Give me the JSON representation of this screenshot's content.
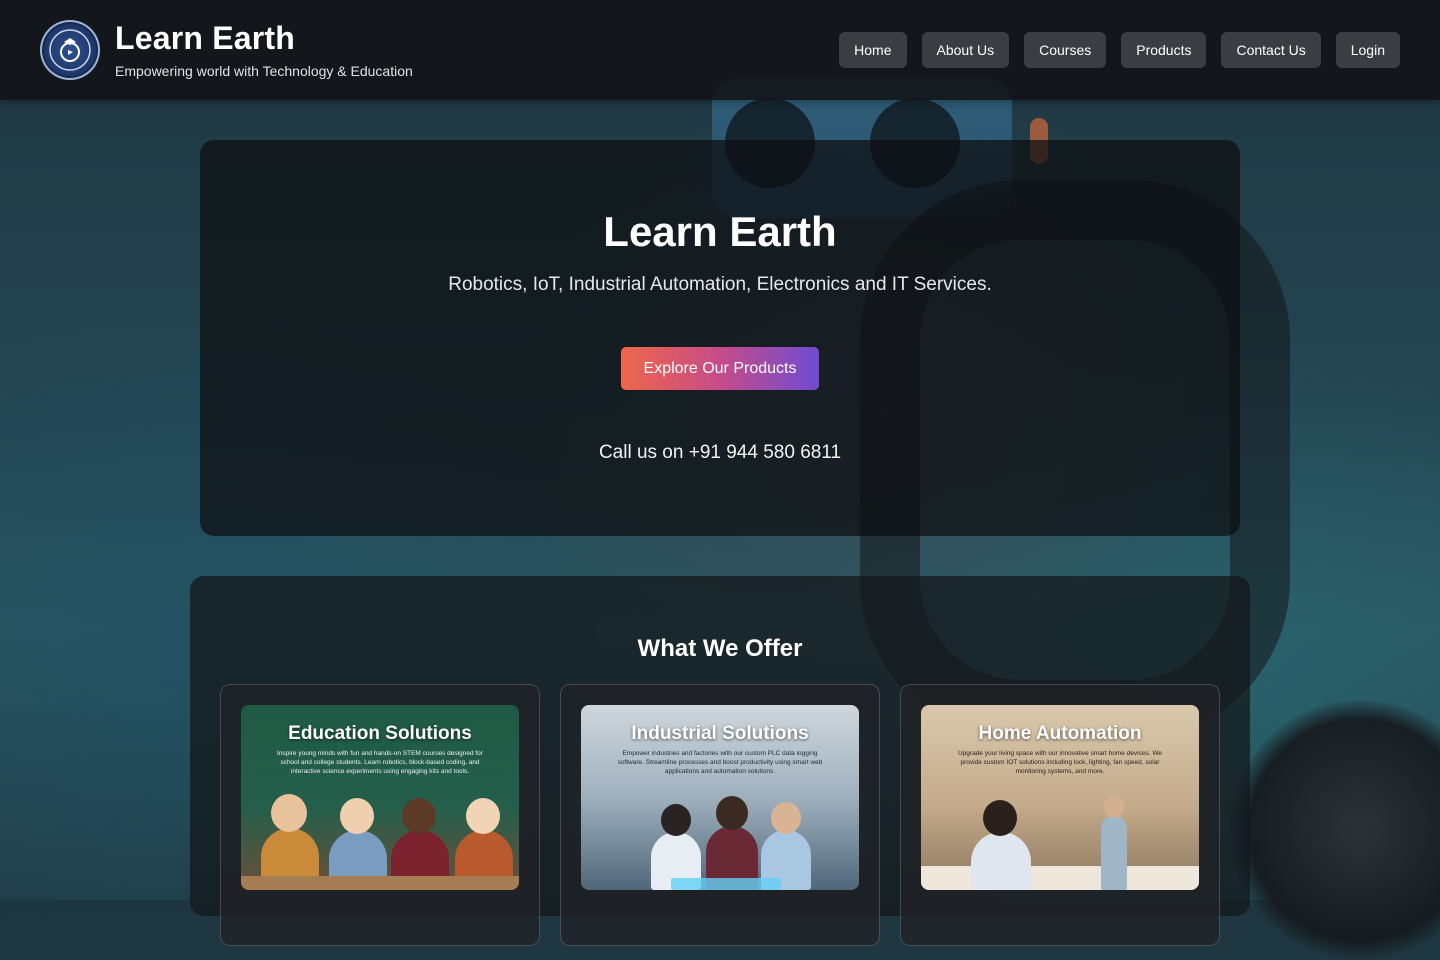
{
  "header": {
    "logo_alt": "Learn Earth logo",
    "title": "Learn Earth",
    "tagline": "Empowering world with Technology & Education"
  },
  "nav": {
    "items": [
      {
        "label": "Home"
      },
      {
        "label": "About Us"
      },
      {
        "label": "Courses"
      },
      {
        "label": "Products"
      },
      {
        "label": "Contact Us"
      },
      {
        "label": "Login"
      }
    ]
  },
  "hero": {
    "title": "Learn Earth",
    "subtitle": "Robotics, IoT, Industrial Automation, Electronics and IT Services.",
    "cta_label": "Explore Our Products",
    "call_text": "Call us on +91 944 580 6811"
  },
  "offer": {
    "title": "What We Offer",
    "cards": [
      {
        "title": "Education Solutions",
        "text": "Inspire young minds with fun and hands-on STEM courses designed for school and college students. Learn robotics, block-based coding, and interactive science experiments using engaging kits and tools."
      },
      {
        "title": "Industrial Solutions",
        "text": "Empower industries and factories with our custom PLC data logging software. Streamline processes and boost productivity using smart web applications and automation solutions."
      },
      {
        "title": "Home Automation",
        "text": "Upgrade your living space with our innovative smart home devices. We provide custom IOT solutions including lock, lighting, fan speed, solar monitoring systems, and more."
      }
    ]
  },
  "colors": {
    "cta_gradient_start": "#f0664a",
    "cta_gradient_end": "#6f4bd2",
    "header_bg": "#121417",
    "nav_button_bg": "#3a3d41"
  }
}
